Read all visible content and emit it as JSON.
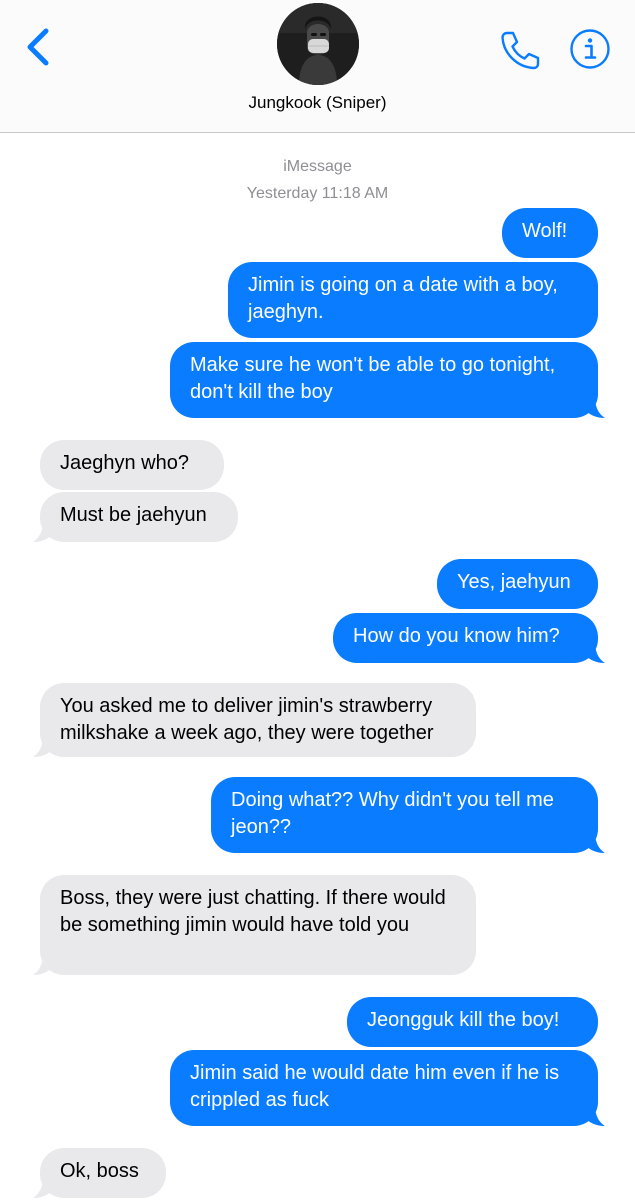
{
  "header": {
    "contact_name": "Jungkook (Sniper)",
    "icons": {
      "back": "chevron-left-icon",
      "call": "phone-icon",
      "info": "info-icon"
    }
  },
  "thread": {
    "service_label": "iMessage",
    "timestamp": "Yesterday 11:18 AM"
  },
  "messages": [
    {
      "from": "me",
      "text": "Wolf!"
    },
    {
      "from": "me",
      "text": "Jimin is going on a date with a boy, jaeghyn."
    },
    {
      "from": "me",
      "text": "Make sure he won't be able to go tonight, don't kill the boy"
    },
    {
      "from": "them",
      "text": "Jaeghyn who?"
    },
    {
      "from": "them",
      "text": "Must be jaehyun"
    },
    {
      "from": "me",
      "text": "Yes, jaehyun"
    },
    {
      "from": "me",
      "text": "How do you know him?"
    },
    {
      "from": "them",
      "text": "You asked me to deliver jimin's strawberry milkshake a week ago, they were together"
    },
    {
      "from": "me",
      "text": "Doing what?? Why didn't you tell me jeon??"
    },
    {
      "from": "them",
      "text": "Boss, they were just chatting. If there would be something jimin would have told you"
    },
    {
      "from": "me",
      "text": "Jeongguk kill the boy!"
    },
    {
      "from": "me",
      "text": "Jimin said he would date him even if he is crippled as fuck"
    },
    {
      "from": "them",
      "text": "Ok, boss"
    }
  ],
  "colors": {
    "sent_bubble": "#0a7cff",
    "received_bubble": "#e9e9eb",
    "accent": "#0a7cff",
    "meta_text": "#8e8e93"
  }
}
